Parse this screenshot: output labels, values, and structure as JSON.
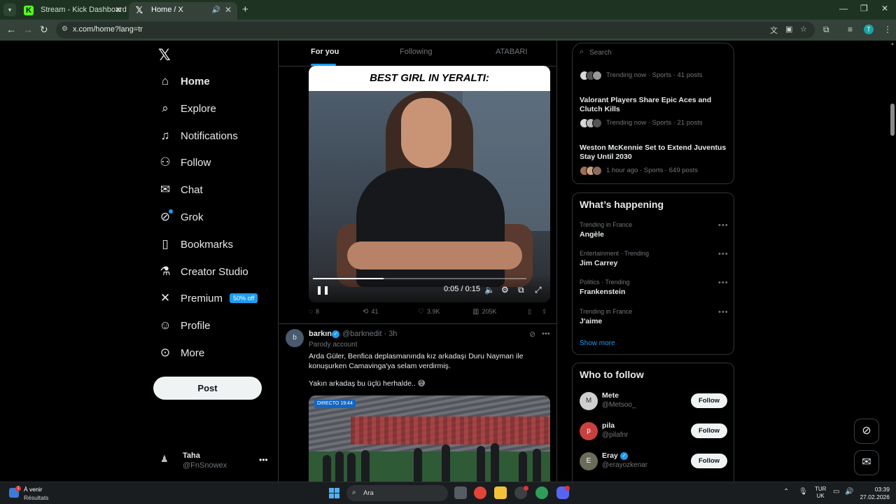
{
  "browser": {
    "tabs": [
      {
        "title": "Stream - Kick Dashboard",
        "active": false
      },
      {
        "title": "Home / X",
        "active": true
      }
    ],
    "url": "x.com/home?lang=tr"
  },
  "nav": {
    "items": [
      {
        "label": "Home",
        "icon": "home-icon"
      },
      {
        "label": "Explore",
        "icon": "search-icon"
      },
      {
        "label": "Notifications",
        "icon": "bell-icon"
      },
      {
        "label": "Follow",
        "icon": "person-plus-icon"
      },
      {
        "label": "Chat",
        "icon": "mail-icon"
      },
      {
        "label": "Grok",
        "icon": "grok-icon"
      },
      {
        "label": "Bookmarks",
        "icon": "bookmark-icon"
      },
      {
        "label": "Creator Studio",
        "icon": "flask-icon"
      },
      {
        "label": "Premium",
        "icon": "x-icon"
      },
      {
        "label": "Profile",
        "icon": "person-icon"
      },
      {
        "label": "More",
        "icon": "more-circle-icon"
      }
    ],
    "premium_badge": "50% off",
    "post_label": "Post",
    "account": {
      "name": "Taha",
      "handle": "@FnSnowex"
    }
  },
  "feed": {
    "tabs": [
      "For you",
      "Following",
      "ATABARI"
    ],
    "video_post": {
      "caption": "BEST GIRL IN YERALTI:",
      "time": "0:05 / 0:15",
      "progress": 0.33,
      "replies": "8",
      "reposts": "41",
      "likes": "3.9K",
      "views": "205K"
    },
    "tweet": {
      "name": "barkın",
      "handle": "@barknedit · 3h",
      "parody": "Parody account",
      "text1": "Arda Güler, Benfica deplasmanında kız arkadaşı Duru Nayman ile konuşurken Camavinga'ya selam verdirmiş.",
      "text2": "Yakın arkadaş bu üçlü herhalde.. 😅",
      "media_tag": "DIRECTO 19:44"
    }
  },
  "right": {
    "search_placeholder": "Search",
    "trends_top": [
      {
        "title": "",
        "meta": "Trending now · Sports · 41 posts"
      },
      {
        "title": "Valorant Players Share Epic Aces and Clutch Kills",
        "meta": "Trending now · Sports · 21 posts"
      },
      {
        "title": "Weston McKennie Set to Extend Juventus Stay Until 2030",
        "meta": "1 hour ago · Sports · 649 posts"
      }
    ],
    "happening": {
      "title": "What’s happening",
      "items": [
        {
          "context": "Trending in France",
          "name": "Angèle"
        },
        {
          "context": "Entertainment · Trending",
          "name": "Jim Carrey"
        },
        {
          "context": "Politics · Trending",
          "name": "Frankenstein"
        },
        {
          "context": "Trending in France",
          "name": "J'aime"
        }
      ],
      "show_more": "Show more"
    },
    "who_to_follow": {
      "title": "Who to follow",
      "users": [
        {
          "name": "Mete",
          "handle": "@Metsoo_",
          "verified": false,
          "button": "Follow",
          "color": "#cfcfcf"
        },
        {
          "name": "pila",
          "handle": "@pilafnr",
          "verified": false,
          "button": "Follow",
          "color": "#c94040"
        },
        {
          "name": "Eray",
          "handle": "@erayozkenar",
          "verified": true,
          "button": "Follow",
          "color": "#6b6b5a"
        }
      ]
    }
  },
  "taskbar": {
    "weather_title": "À venir",
    "weather_sub": "Résultats",
    "weather_badge": "1",
    "search_label": "Ara",
    "lang_line1": "TUR",
    "lang_line2": "UK",
    "time": "03:39",
    "date": "27.02.2026"
  }
}
